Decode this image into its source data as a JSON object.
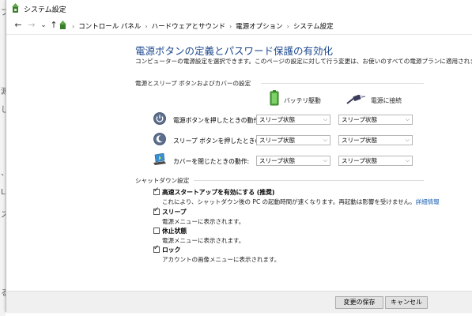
{
  "background": {
    "chars": [
      "プ",
      "源",
      "し",
      "、",
      "L",
      "ス",
      "る"
    ]
  },
  "window": {
    "title": "システム設定",
    "icon": "power-options-icon"
  },
  "nav": {
    "back": "←",
    "forward": "→",
    "recent": "⌄",
    "up": "↑",
    "breadcrumb": [
      "コントロール パネル",
      "ハードウェアとサウンド",
      "電源オプション",
      "システム設定"
    ]
  },
  "heading": "電源ボタンの定義とパスワード保護の有効化",
  "description": "コンピューターの電源設定を選択できます。このページの設定に対して行う変更は、お使いのすべての電源プランに適用されます。",
  "power_section": {
    "title": "電源とスリープ ボタンおよびカバーの設定",
    "col_battery": "バッテリ駆動",
    "col_plugged": "電源に接続",
    "rows": [
      {
        "label": "電源ボタンを押したときの動作:",
        "battery": "スリープ状態",
        "plugged": "スリープ状態",
        "icon": "power-button-icon"
      },
      {
        "label": "スリープ ボタンを押したときの動作:",
        "battery": "スリープ状態",
        "plugged": "スリープ状態",
        "icon": "sleep-button-icon"
      },
      {
        "label": "カバーを閉じたときの動作:",
        "battery": "スリープ状態",
        "plugged": "スリープ状態",
        "icon": "laptop-lid-icon"
      }
    ]
  },
  "shutdown_section": {
    "title": "シャットダウン設定",
    "items": [
      {
        "title": "高速スタートアップを有効にする (推奨)",
        "desc": "これにより、シャットダウン後の PC の起動時間が速くなります。再起動は影響を受けません。",
        "link": "詳細情報",
        "checked": true
      },
      {
        "title": "スリープ",
        "desc": "電源メニューに表示されます。",
        "checked": true
      },
      {
        "title": "休止状態",
        "desc": "電源メニューに表示されます。",
        "checked": false
      },
      {
        "title": "ロック",
        "desc": "アカウントの画像メニューに表示されます。",
        "checked": true
      }
    ]
  },
  "footer": {
    "save": "変更の保存",
    "cancel": "キャンセル"
  },
  "colors": {
    "heading": "#1e4a8e",
    "link": "#1a5fb4"
  }
}
